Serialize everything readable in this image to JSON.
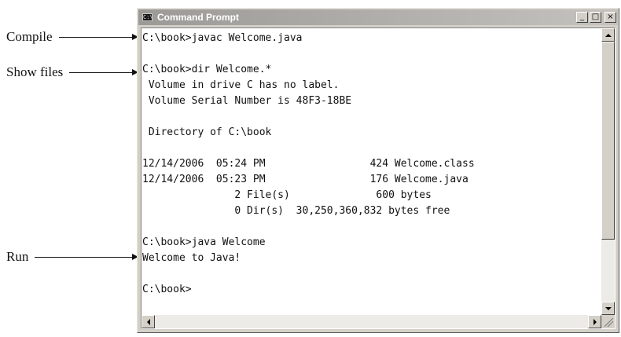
{
  "callouts": {
    "compile": "Compile",
    "show_files": "Show files",
    "run": "Run"
  },
  "window": {
    "title": "Command Prompt",
    "icon_glyph": "C:\\",
    "minimize": "_",
    "maximize": "□",
    "close": "×"
  },
  "console": {
    "lines": [
      "C:\\book>javac Welcome.java",
      "",
      "C:\\book>dir Welcome.*",
      " Volume in drive C has no label.",
      " Volume Serial Number is 48F3-18BE",
      "",
      " Directory of C:\\book",
      "",
      "12/14/2006  05:24 PM                 424 Welcome.class",
      "12/14/2006  05:23 PM                 176 Welcome.java",
      "               2 File(s)              600 bytes",
      "               0 Dir(s)  30,250,360,832 bytes free",
      "",
      "C:\\book>java Welcome",
      "Welcome to Java!",
      "",
      "C:\\book>"
    ]
  },
  "icons": {
    "window_icon": "command-prompt-icon",
    "scroll_up": "arrow-up-icon",
    "scroll_down": "arrow-down-icon",
    "scroll_left": "arrow-left-icon",
    "scroll_right": "arrow-right-icon"
  }
}
